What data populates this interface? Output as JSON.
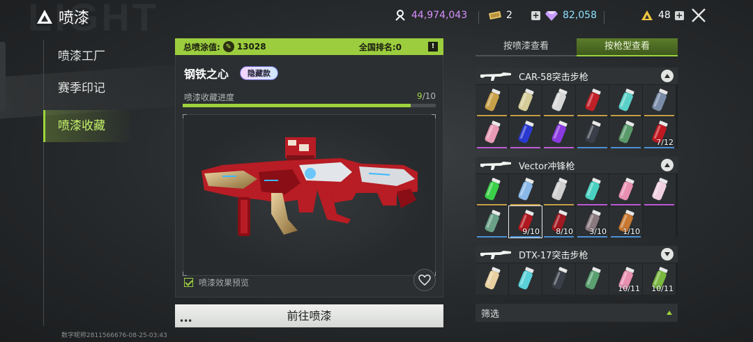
{
  "header": {
    "title": "喷漆",
    "bg_word": "LIGHT",
    "currencies": [
      {
        "icon": "token-icon",
        "value": "44,974,043",
        "color": "#d890ff"
      },
      {
        "icon": "ticket-icon",
        "value": "2"
      },
      {
        "icon": "diamond-icon",
        "value": "82,058",
        "color": "#8ee0ff"
      },
      {
        "icon": "rank-icon",
        "value": "48"
      }
    ]
  },
  "nav": {
    "items": [
      "喷漆工厂",
      "赛季印记",
      "喷漆收藏"
    ],
    "active_index": 2
  },
  "footer": {
    "user_id": "数字昵称2811566676-08-25-03:43"
  },
  "stats": {
    "total_label": "总喷涂值:",
    "total_value": "13028",
    "rank_label": "全国排名:0",
    "info_icon": "!"
  },
  "spray": {
    "name": "钢铁之心",
    "badge": "隐藏款",
    "progress_label": "喷漆收藏进度",
    "progress_current": "9",
    "progress_total": "/10",
    "progress_fraction": 0.9,
    "preview_label": "喷漆效果预览",
    "preview_checked": true
  },
  "actions": {
    "go_label": "前往喷漆"
  },
  "tabs": {
    "by_spray": "按喷漆查看",
    "by_gun": "按枪型查看",
    "active": "by_gun"
  },
  "groups": [
    {
      "name": "CAR-58突击步枪",
      "expanded": true,
      "cells": [
        {
          "color": "#c8a04a",
          "bar": "#c8a04a"
        },
        {
          "color": "#d6cc9a",
          "bar": "#c8a04a"
        },
        {
          "color": "#d8d8d8",
          "bar": "#c8a04a"
        },
        {
          "color": "#c02028",
          "bar": "#c8a04a"
        },
        {
          "color": "#5ad0c8",
          "bar": "#c8a04a"
        },
        {
          "color": "#7a8ca8",
          "bar": "#c8a04a"
        },
        {
          "color": "#e89ab4",
          "bar": "#c05ad8"
        },
        {
          "color": "#2a3ad0",
          "bar": "#c05ad8"
        },
        {
          "color": "#8a3ae0",
          "bar": "#c05ad8"
        },
        {
          "color": "#3a3e48",
          "bar": "#4a90d8"
        },
        {
          "color": "#5a9a6a",
          "bar": "#4a90d8"
        },
        {
          "color": "#c01820",
          "bar": "#4a90d8",
          "count": "7/12"
        }
      ]
    },
    {
      "name": "Vector冲锋枪",
      "expanded": true,
      "cells": [
        {
          "color": "#3ad048",
          "bar": "#c8a04a"
        },
        {
          "color": "#8ab8e8",
          "bar": "#c8a04a"
        },
        {
          "color": "#d0d0d0",
          "bar": "#c8a04a"
        },
        {
          "color": "#4ad0c0",
          "bar": "#c05ad8"
        },
        {
          "color": "#e890b0",
          "bar": "#c05ad8"
        },
        {
          "color": "#f0d0e0",
          "bar": "#c05ad8"
        },
        {
          "color": "#6aa088",
          "bar": "#4a90d8"
        },
        {
          "color": "#b01820",
          "bar": "#4a90d8",
          "count": "9/10",
          "selected": true
        },
        {
          "color": "#a01820",
          "bar": "#4a90d8",
          "count": "8/10"
        },
        {
          "color": "#8a7a80",
          "bar": "#4a90d8",
          "count": "3/10"
        },
        {
          "color": "#c87830",
          "bar": "#4a90d8",
          "count": "1/10"
        },
        {
          "empty": true
        }
      ]
    },
    {
      "name": "DTX-17突击步枪",
      "expanded": false,
      "cells": [
        {
          "color": "#e8d0a0"
        },
        {
          "color": "#5ad0d8"
        },
        {
          "color": "#3a3e48"
        },
        {
          "color": "#5aa070"
        },
        {
          "color": "#e890b0",
          "count": "10/11"
        },
        {
          "color": "#7ab840",
          "count": "10/11"
        }
      ]
    }
  ],
  "filter": {
    "label": "筛选"
  }
}
